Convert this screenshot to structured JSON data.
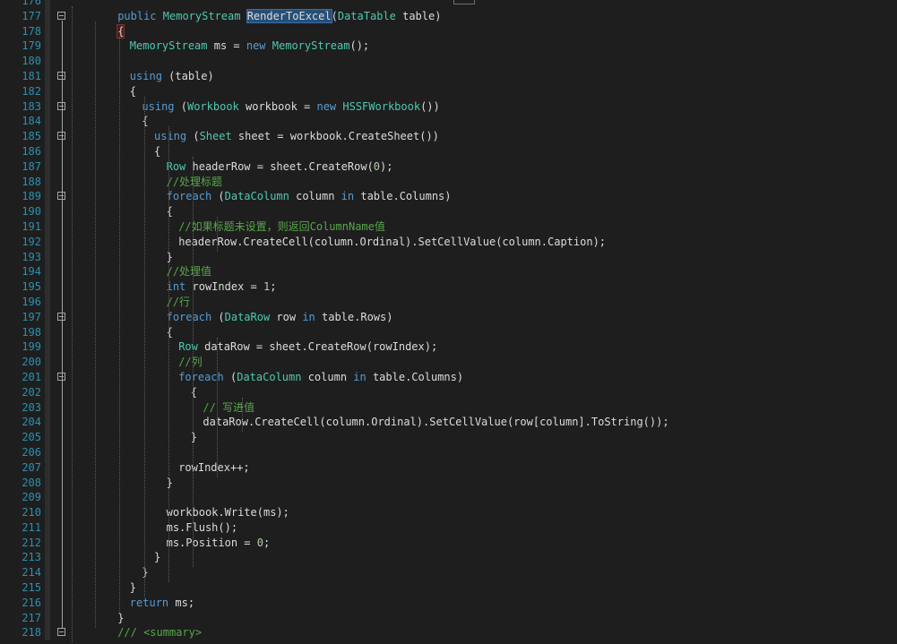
{
  "editor": {
    "lines": [
      {
        "n": "176",
        "tokens": [],
        "fold": false
      },
      {
        "n": "177",
        "tokens": [
          [
            "kw",
            "public "
          ],
          [
            "ty",
            "MemoryStream "
          ],
          [
            "hl",
            "RenderToExcel"
          ],
          [
            "",
            "("
          ],
          [
            "ty",
            "DataTable"
          ],
          [
            "",
            " table)"
          ]
        ],
        "fold": true
      },
      {
        "n": "178",
        "tokens": [
          [
            "brace-hl",
            "{"
          ]
        ],
        "fold": false
      },
      {
        "n": "179",
        "tokens": [
          [
            "ty",
            "MemoryStream"
          ],
          [
            "",
            " ms = "
          ],
          [
            "kw",
            "new "
          ],
          [
            "ty",
            "MemoryStream"
          ],
          [
            "",
            "();"
          ]
        ],
        "fold": false
      },
      {
        "n": "180",
        "tokens": [],
        "fold": false
      },
      {
        "n": "181",
        "tokens": [
          [
            "kw",
            "using"
          ],
          [
            "",
            " (table)"
          ]
        ],
        "fold": true
      },
      {
        "n": "182",
        "tokens": [
          [
            "",
            "{"
          ]
        ],
        "fold": false
      },
      {
        "n": "183",
        "tokens": [
          [
            "kw",
            "using"
          ],
          [
            "",
            " ("
          ],
          [
            "ty",
            "Workbook"
          ],
          [
            "",
            " workbook = "
          ],
          [
            "kw",
            "new "
          ],
          [
            "ty",
            "HSSFWorkbook"
          ],
          [
            "",
            "())"
          ]
        ],
        "fold": true
      },
      {
        "n": "184",
        "tokens": [
          [
            "",
            "{"
          ]
        ],
        "fold": false
      },
      {
        "n": "185",
        "tokens": [
          [
            "kw",
            "using"
          ],
          [
            "",
            " ("
          ],
          [
            "ty",
            "Sheet"
          ],
          [
            "",
            " sheet = workbook.CreateSheet())"
          ]
        ],
        "fold": true
      },
      {
        "n": "186",
        "tokens": [
          [
            "",
            "{"
          ]
        ],
        "fold": false
      },
      {
        "n": "187",
        "tokens": [
          [
            "ty",
            "Row"
          ],
          [
            "",
            " headerRow = sheet.CreateRow("
          ],
          [
            "nu",
            "0"
          ],
          [
            "",
            ");"
          ]
        ],
        "fold": false
      },
      {
        "n": "188",
        "tokens": [
          [
            "cm",
            "//处理标题"
          ]
        ],
        "fold": false
      },
      {
        "n": "189",
        "tokens": [
          [
            "kw",
            "foreach"
          ],
          [
            "",
            " ("
          ],
          [
            "ty",
            "DataColumn"
          ],
          [
            "",
            " column "
          ],
          [
            "kw",
            "in"
          ],
          [
            "",
            " table.Columns)"
          ]
        ],
        "fold": true
      },
      {
        "n": "190",
        "tokens": [
          [
            "",
            "{"
          ]
        ],
        "fold": false
      },
      {
        "n": "191",
        "tokens": [
          [
            "cm",
            "//如果标题未设置，则返回ColumnName值"
          ]
        ],
        "fold": false
      },
      {
        "n": "192",
        "tokens": [
          [
            "",
            "headerRow.CreateCell(column.Ordinal).SetCellValue(column.Caption);"
          ]
        ],
        "fold": false
      },
      {
        "n": "193",
        "tokens": [
          [
            "",
            "}"
          ]
        ],
        "fold": false
      },
      {
        "n": "194",
        "tokens": [
          [
            "cm",
            "//处理值"
          ]
        ],
        "fold": false
      },
      {
        "n": "195",
        "tokens": [
          [
            "kw",
            "int"
          ],
          [
            "",
            " rowIndex = "
          ],
          [
            "nu",
            "1"
          ],
          [
            "",
            ";"
          ]
        ],
        "fold": false
      },
      {
        "n": "196",
        "tokens": [
          [
            "cm",
            "//行"
          ]
        ],
        "fold": false
      },
      {
        "n": "197",
        "tokens": [
          [
            "kw",
            "foreach"
          ],
          [
            "",
            " ("
          ],
          [
            "ty",
            "DataRow"
          ],
          [
            "",
            " row "
          ],
          [
            "kw",
            "in"
          ],
          [
            "",
            " table.Rows)"
          ]
        ],
        "fold": true
      },
      {
        "n": "198",
        "tokens": [
          [
            "",
            "{"
          ]
        ],
        "fold": false
      },
      {
        "n": "199",
        "tokens": [
          [
            "ty",
            "Row"
          ],
          [
            "",
            " dataRow = sheet.CreateRow(rowIndex);"
          ]
        ],
        "fold": false
      },
      {
        "n": "200",
        "tokens": [
          [
            "cm",
            "//列"
          ]
        ],
        "fold": false
      },
      {
        "n": "201",
        "tokens": [
          [
            "kw",
            "foreach"
          ],
          [
            "",
            " ("
          ],
          [
            "ty",
            "DataColumn"
          ],
          [
            "",
            " column "
          ],
          [
            "kw",
            "in"
          ],
          [
            "",
            " table.Columns)"
          ]
        ],
        "fold": true
      },
      {
        "n": "202",
        "tokens": [
          [
            "",
            "{"
          ]
        ],
        "fold": false
      },
      {
        "n": "203",
        "tokens": [
          [
            "cm",
            "// 写进值"
          ]
        ],
        "fold": false
      },
      {
        "n": "204",
        "tokens": [
          [
            "",
            "dataRow.CreateCell(column.Ordinal).SetCellValue(row[column].ToString());"
          ]
        ],
        "fold": false
      },
      {
        "n": "205",
        "tokens": [
          [
            "",
            "}"
          ]
        ],
        "fold": false
      },
      {
        "n": "206",
        "tokens": [],
        "fold": false
      },
      {
        "n": "207",
        "tokens": [
          [
            "",
            "rowIndex++;"
          ]
        ],
        "fold": false
      },
      {
        "n": "208",
        "tokens": [
          [
            "",
            "}"
          ]
        ],
        "fold": false
      },
      {
        "n": "209",
        "tokens": [],
        "fold": false
      },
      {
        "n": "210",
        "tokens": [
          [
            "",
            "workbook.Write(ms);"
          ]
        ],
        "fold": false
      },
      {
        "n": "211",
        "tokens": [
          [
            "",
            "ms.Flush();"
          ]
        ],
        "fold": false
      },
      {
        "n": "212",
        "tokens": [
          [
            "",
            "ms.Position = "
          ],
          [
            "nu",
            "0"
          ],
          [
            "",
            ";"
          ]
        ],
        "fold": false
      },
      {
        "n": "213",
        "tokens": [
          [
            "",
            "}"
          ]
        ],
        "fold": false
      },
      {
        "n": "214",
        "tokens": [
          [
            "",
            "}"
          ]
        ],
        "fold": false
      },
      {
        "n": "215",
        "tokens": [
          [
            "",
            "}"
          ]
        ],
        "fold": false
      },
      {
        "n": "216",
        "tokens": [
          [
            "kw",
            "return"
          ],
          [
            "",
            " ms;"
          ]
        ],
        "fold": false
      },
      {
        "n": "217",
        "tokens": [
          [
            "",
            "}"
          ]
        ],
        "fold": false
      },
      {
        "n": "218",
        "tokens": [
          [
            "cm",
            "/// <summary>"
          ]
        ],
        "fold": true
      }
    ]
  },
  "colors": {
    "background": "#1e1e1e",
    "line_number": "#2b91af",
    "keyword": "#569cd6",
    "type": "#4ec9b0",
    "comment": "#57a64a",
    "number": "#b5cea8",
    "text": "#dcdcdc"
  }
}
